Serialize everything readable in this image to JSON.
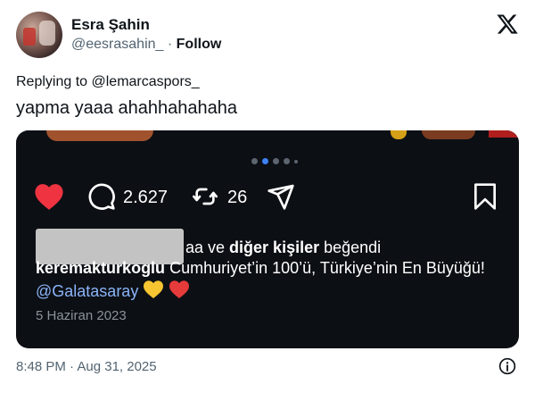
{
  "author": {
    "name": "Esra Şahin",
    "handle": "@eesrasahin_",
    "separator": "·",
    "follow_label": "Follow"
  },
  "reply_to": "Replying to @lemarcaspors_",
  "tweet_text": "yapma yaaa ahahhahahaha",
  "embed": {
    "comment_count": "2.627",
    "repost_count": "26",
    "likes_text_suffix": "aa ve ",
    "likes_others": "diğer kişiler",
    "likes_verb": " beğendi",
    "caption_user": "keremakturkoglu",
    "caption_text": " Cumhuriyet’in 100’ü, Türkiye’nin En Büyüğü! ",
    "caption_mention": "@Galatasaray",
    "post_date": "5 Haziran 2023",
    "carousel": {
      "count": 5,
      "active_index": 1
    },
    "colors": {
      "background": "#0c0f14",
      "heart": "#ef3340",
      "mention": "#8ab4f8",
      "dot_active": "#3d82f6"
    }
  },
  "footer": {
    "timestamp": "8:48 PM · Aug 31, 2025"
  },
  "icons": [
    "x-logo-icon",
    "heart-icon",
    "comment-icon",
    "repost-icon",
    "share-icon",
    "bookmark-icon",
    "yellow-heart-icon",
    "red-heart-icon",
    "info-icon"
  ]
}
